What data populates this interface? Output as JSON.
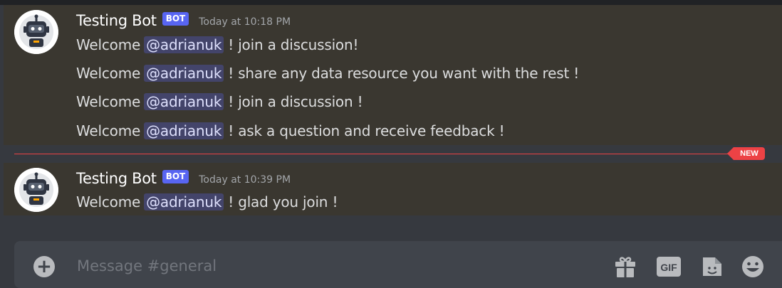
{
  "channel": "general",
  "divider": {
    "new_label": "NEW"
  },
  "groups": [
    {
      "username": "Testing Bot",
      "tag": "BOT",
      "timestamp": "Today at 10:18 PM",
      "messages": [
        {
          "prefix": "Welcome",
          "mention": "@adrianuk",
          "text": "! join a discussion!"
        },
        {
          "prefix": "Welcome",
          "mention": "@adrianuk",
          "text": "! share any data resource you want with the rest !"
        },
        {
          "prefix": "Welcome",
          "mention": "@adrianuk",
          "text": "! join a discussion !"
        },
        {
          "prefix": "Welcome",
          "mention": "@adrianuk",
          "text": "! ask a question and receive feedback !"
        }
      ]
    },
    {
      "username": "Testing Bot",
      "tag": "BOT",
      "timestamp": "Today at 10:39 PM",
      "messages": [
        {
          "prefix": "Welcome",
          "mention": "@adrianuk",
          "text": "! glad you join !"
        }
      ]
    }
  ],
  "composer": {
    "placeholder": "Message #general",
    "gif_label": "GIF",
    "icons": [
      "plus-icon",
      "gift-icon",
      "gif-icon",
      "sticker-icon",
      "emoji-icon"
    ]
  },
  "colors": {
    "accent": "#5865f2",
    "new_divider": "#ed4245",
    "background": "#36393f",
    "highlight": "#3a3730"
  }
}
